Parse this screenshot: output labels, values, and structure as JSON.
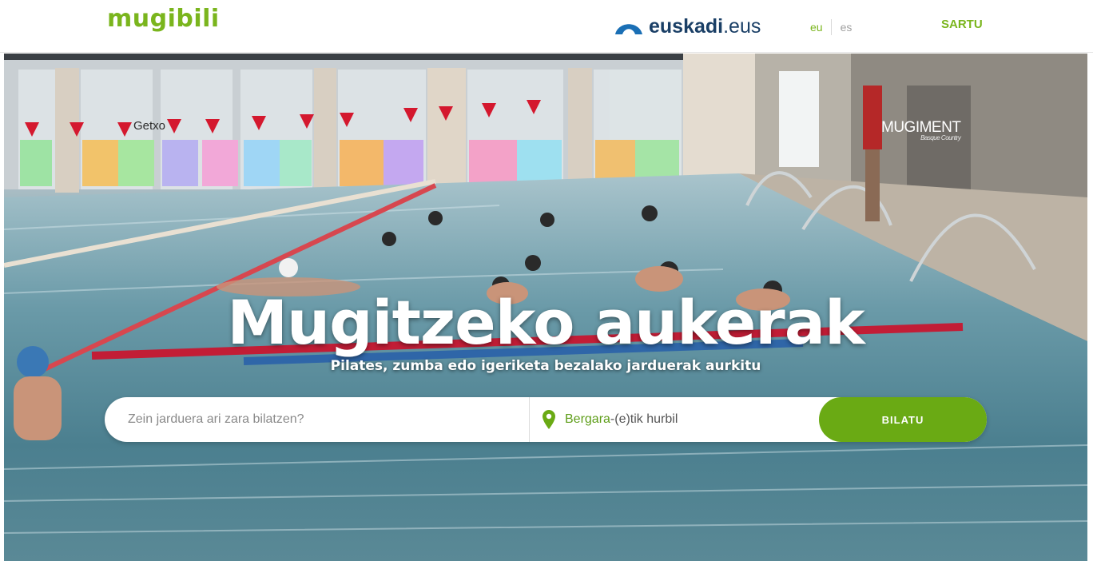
{
  "header": {
    "logo": "mugibili",
    "partner": {
      "bold": "euskadi",
      "rest": ".eus"
    },
    "languages": {
      "eu": "eu",
      "es": "es"
    },
    "login_label": "SARTU"
  },
  "hero": {
    "title": "Mugitzeko aukerak",
    "subtitle": "Pilates, zumba edo igeriketa bezalako jarduerak aurkitu",
    "watermark_left": "Getxo",
    "watermark_right": "MUGIMENT",
    "watermark_right_sub": "Basque Country"
  },
  "search": {
    "placeholder": "Zein jarduera ari zara bilatzen?",
    "location_city": "Bergara",
    "location_suffix": "-(e)tik hurbil",
    "button_label": "BILATU"
  },
  "colors": {
    "brand_green": "#7ab51d",
    "button_green": "#6aaa14",
    "euskadi_blue": "#1a3f66"
  },
  "icons": {
    "location": "map-pin-icon",
    "partner": "euskadi-logo-icon"
  }
}
